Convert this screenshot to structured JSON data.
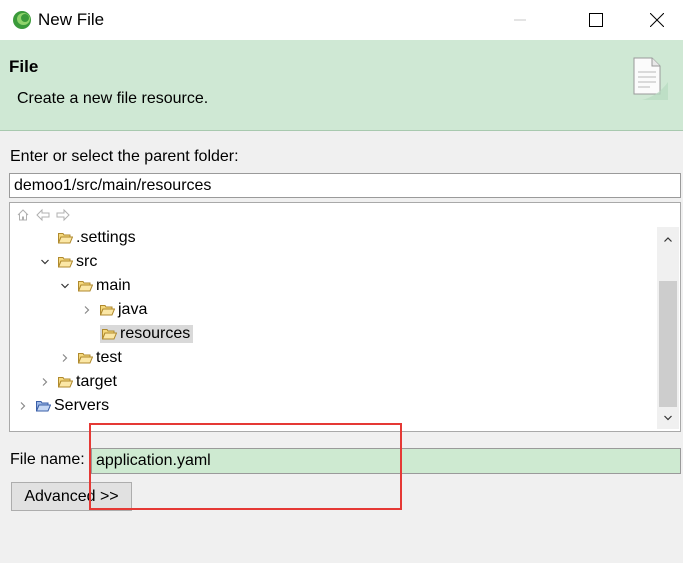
{
  "window": {
    "title": "New File",
    "controls": {
      "minimize_glyph": "—",
      "maximize_glyph": "☐",
      "close_glyph": "✕"
    }
  },
  "banner": {
    "title": "File",
    "description": "Create a new file resource.",
    "icon": "new-file-wizard-icon"
  },
  "parent_folder": {
    "label": "Enter or select the parent folder:",
    "value": "demoo1/src/main/resources"
  },
  "tree": {
    "toolbar": [
      "home-icon",
      "back-arrow-icon",
      "forward-arrow-icon"
    ],
    "rows": [
      {
        "label": ".settings",
        "expanded": null,
        "selected": false
      },
      {
        "label": "src",
        "expanded": true,
        "selected": false
      },
      {
        "label": "main",
        "expanded": true,
        "selected": false
      },
      {
        "label": "java",
        "expanded": false,
        "selected": false
      },
      {
        "label": "resources",
        "expanded": null,
        "selected": true
      },
      {
        "label": "test",
        "expanded": false,
        "selected": false
      },
      {
        "label": "target",
        "expanded": false,
        "selected": false
      },
      {
        "label": "Servers",
        "expanded": false,
        "selected": false
      }
    ]
  },
  "file_name": {
    "label": "File name:",
    "value": "application.yaml"
  },
  "advanced_button": {
    "label": "Advanced >>"
  },
  "colors": {
    "banner_bg": "#cfe8d4",
    "filename_bg": "#ceead1",
    "annotation": "#e53935"
  }
}
